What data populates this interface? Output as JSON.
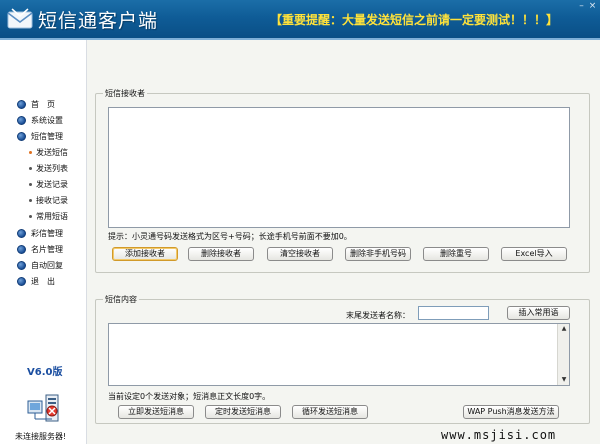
{
  "header": {
    "title": "短信通客户端",
    "warning": "【重要提醒：大量发送短信之前请一定要测试！！！】",
    "app_icon": "envelope-icon",
    "min_icon": "minimize-icon",
    "close_icon": "close-icon",
    "min_glyph": "–",
    "close_glyph": "×"
  },
  "sidebar": {
    "nav": [
      {
        "label": "首　页",
        "icon": "bullet-icon"
      },
      {
        "label": "系统设置",
        "icon": "bullet-icon"
      },
      {
        "label": "短信管理",
        "icon": "bullet-icon"
      },
      {
        "label": "彩信管理",
        "icon": "bullet-icon"
      },
      {
        "label": "名片管理",
        "icon": "bullet-icon"
      },
      {
        "label": "自动回复",
        "icon": "bullet-icon"
      },
      {
        "label": "退　出",
        "icon": "bullet-icon"
      }
    ],
    "sub": [
      {
        "label": "发送短信",
        "active": true
      },
      {
        "label": "发送列表",
        "active": false
      },
      {
        "label": "发送记录",
        "active": false
      },
      {
        "label": "接收记录",
        "active": false
      },
      {
        "label": "常用短语",
        "active": false
      }
    ],
    "version": "V6.0版",
    "server_icon": "server-network-icon",
    "server_status": "未连接服务器!"
  },
  "recipients": {
    "legend": "短信接收者",
    "hint": "提示：小灵通号码发送格式为区号+号码；长途手机号前面不要加0。",
    "buttons": [
      "添加接收者",
      "删除接收者",
      "清空接收者",
      "删除非手机号码",
      "删除重号",
      "Excel导入"
    ]
  },
  "content": {
    "legend": "短信内容",
    "sender_label": "末尾发送者名称：",
    "sender_value": "",
    "insert_phrase_button": "插入常用语",
    "status": "当前设定0个发送对象；短消息正文长度0字。",
    "buttons": [
      "立即发送短消息",
      "定时发送短消息",
      "循环发送短消息",
      "WAP Push消息发送方法"
    ]
  },
  "scroll": {
    "up": "▲",
    "down": "▼"
  },
  "watermark": "www.msjisi.com",
  "colors": {
    "header_bg": "#0f5c97",
    "warning": "#ffe23a",
    "panel_bg": "#f4f5f1",
    "version": "#1a4ea0",
    "active_sub": "#e0711f"
  }
}
